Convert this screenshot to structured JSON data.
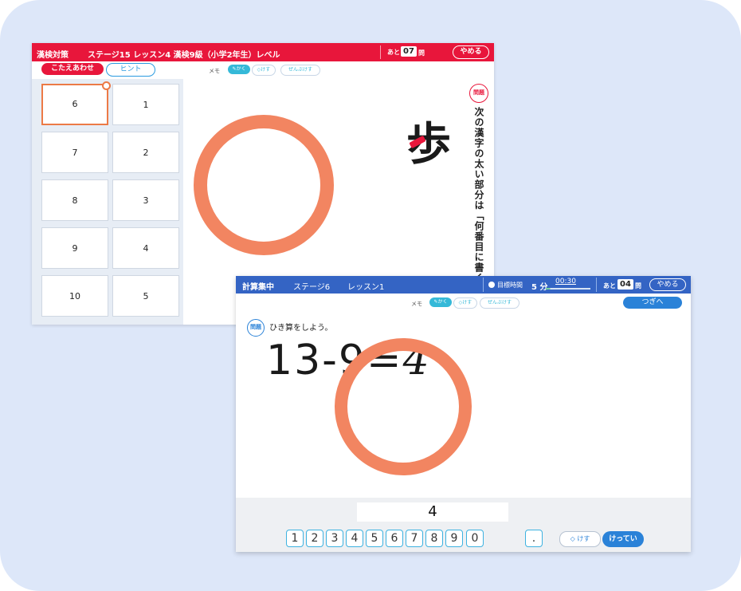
{
  "back_window": {
    "header_title": "漢検対策",
    "header_info": "ステージ15  レッスン4  漢検9級（小学2年生）レベル",
    "remaining_label": "あと",
    "remaining_count": "07",
    "remaining_unit": "問",
    "quit_label": "やめる",
    "answer_button": "こたえあわせ",
    "hint_button": "ヒント",
    "memo_label": "メモ",
    "draw_label": "かく",
    "erase_label": "けす",
    "erase_all_label": "ぜんぶけす",
    "choices": [
      "6",
      "7",
      "8",
      "9",
      "10",
      "1",
      "2",
      "3",
      "4",
      "5"
    ],
    "selected_choice": "6",
    "kanji": "歩",
    "question_badge": "問題",
    "question_text": "次の漢字の太い部分は「何番目に書くか"
  },
  "front_window": {
    "header_title": "計算集中",
    "stage": "ステージ6",
    "lesson": "レッスン1",
    "goal_label": "目標時間",
    "goal_minutes": "5 分",
    "elapsed": "00:30",
    "goal_progress": 0.1,
    "remaining_label": "あと",
    "remaining_count": "04",
    "remaining_unit": "問",
    "quit_label": "やめる",
    "memo_label": "メモ",
    "draw_label": "かく",
    "erase_label": "けす",
    "erase_all_label": "ぜんぶけす",
    "next_button": "つぎへ",
    "question_badge": "問題",
    "instruction": "ひき算をしよう。",
    "equation": "13-9=",
    "handwritten_answer": "4",
    "answer_display": "4",
    "keypad": [
      "1",
      "2",
      "3",
      "4",
      "5",
      "6",
      "7",
      "8",
      "9",
      "0",
      "."
    ],
    "erase_button": "けす",
    "decide_button": "けってい"
  },
  "colors": {
    "kanken_red": "#e8163b",
    "keisan_blue": "#3464c4",
    "correct_circle": "#f28561",
    "background": "#dde7f9"
  }
}
